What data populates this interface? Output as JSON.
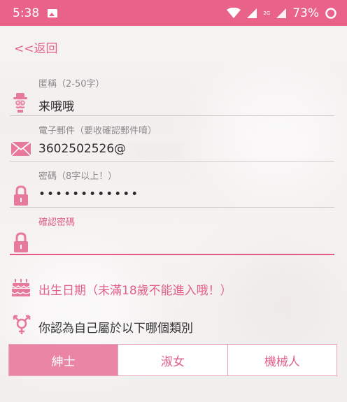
{
  "status_bar": {
    "time": "5:38",
    "network": "2G",
    "battery": "73%"
  },
  "nav": {
    "back_label": "<<返回"
  },
  "form": {
    "nickname": {
      "label": "匿稱（2-50字）",
      "value": "来哦哦",
      "icon": "gentleman-icon"
    },
    "email": {
      "label": "電子郵件（要收確認郵件唷）",
      "value": "3602502526@",
      "icon": "envelope-icon"
    },
    "password": {
      "label": "密碼（8字以上！）",
      "value": "••••••••••••",
      "icon": "lock-icon"
    },
    "confirm_password": {
      "label": "確認密碼",
      "value": "",
      "icon": "lock-icon"
    }
  },
  "birthday_label": "出生日期（未滿18歲不能進入哦！）",
  "gender_question": "你認為自己屬於以下哪個類別",
  "gender_options": [
    {
      "label": "紳士",
      "selected": true
    },
    {
      "label": "淑女",
      "selected": false
    },
    {
      "label": "機械人",
      "selected": false
    }
  ],
  "colors": {
    "accent": "#e9628a",
    "selected_segment": "#eb85a6"
  }
}
